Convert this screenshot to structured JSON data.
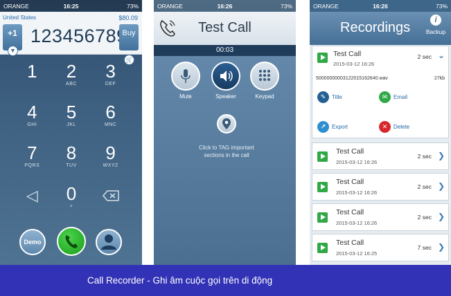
{
  "status": {
    "carrier": "ORANGE",
    "time": "16:25",
    "battery": "73%"
  },
  "status2": {
    "carrier": "ORANGE",
    "time": "16:26",
    "battery": "73%"
  },
  "dialer": {
    "country": "United States",
    "credit": "$80.09",
    "country_code": "+1",
    "number": "123456789",
    "buy_label": "Buy",
    "keys": [
      {
        "digit": "1",
        "letters": ""
      },
      {
        "digit": "2",
        "letters": "ABC"
      },
      {
        "digit": "3",
        "letters": "DEF"
      },
      {
        "digit": "4",
        "letters": "GHI"
      },
      {
        "digit": "5",
        "letters": "JKL"
      },
      {
        "digit": "6",
        "letters": "MNC"
      },
      {
        "digit": "7",
        "letters": "PQRS"
      },
      {
        "digit": "8",
        "letters": "TUV"
      },
      {
        "digit": "9",
        "letters": "WXYZ"
      },
      {
        "digit": "0",
        "letters": "+"
      }
    ],
    "demo_label": "Demo"
  },
  "test_call": {
    "title": "Test Call",
    "timer": "00:03",
    "mute_label": "Mute",
    "speaker_label": "Speaker",
    "keypad_label": "Keypad",
    "tag_text": "Click to TAG important sections in the call"
  },
  "recordings": {
    "title": "Recordings",
    "backup_label": "Backup",
    "expanded": {
      "name": "Test Call",
      "date": "2015-03-12 16:26",
      "duration": "2 sec",
      "file": "50000000003122015162640.wav",
      "size": "27kb",
      "title_action": "Title",
      "email_action": "Email",
      "export_action": "Export",
      "delete_action": "Delete"
    },
    "items": [
      {
        "name": "Test Call",
        "date": "2015-03-12 16:26",
        "duration": "2 sec"
      },
      {
        "name": "Test Call",
        "date": "2015-03-12 16:26",
        "duration": "2 sec"
      },
      {
        "name": "Test Call",
        "date": "2015-03-12 16:26",
        "duration": "2 sec"
      },
      {
        "name": "Test Call",
        "date": "2015-03-12 16:25",
        "duration": "7 sec"
      }
    ]
  },
  "caption": "Call Recorder - Ghi âm cuộc gọi trên di động",
  "colors": {
    "caption_bg": "#3232b6",
    "accent_blue": "#2468a6",
    "play_green": "#2fa845",
    "delete_red": "#d7262c"
  },
  "icons": [
    "chevron-down-icon",
    "cart-icon",
    "backspace-icon",
    "left-arrow-icon",
    "phone-icon",
    "contact-icon",
    "microphone-icon",
    "speaker-icon",
    "keypad-icon",
    "location-pin-icon",
    "info-icon",
    "play-icon",
    "edit-icon",
    "email-icon",
    "export-icon",
    "delete-icon",
    "chevron-right-icon"
  ]
}
